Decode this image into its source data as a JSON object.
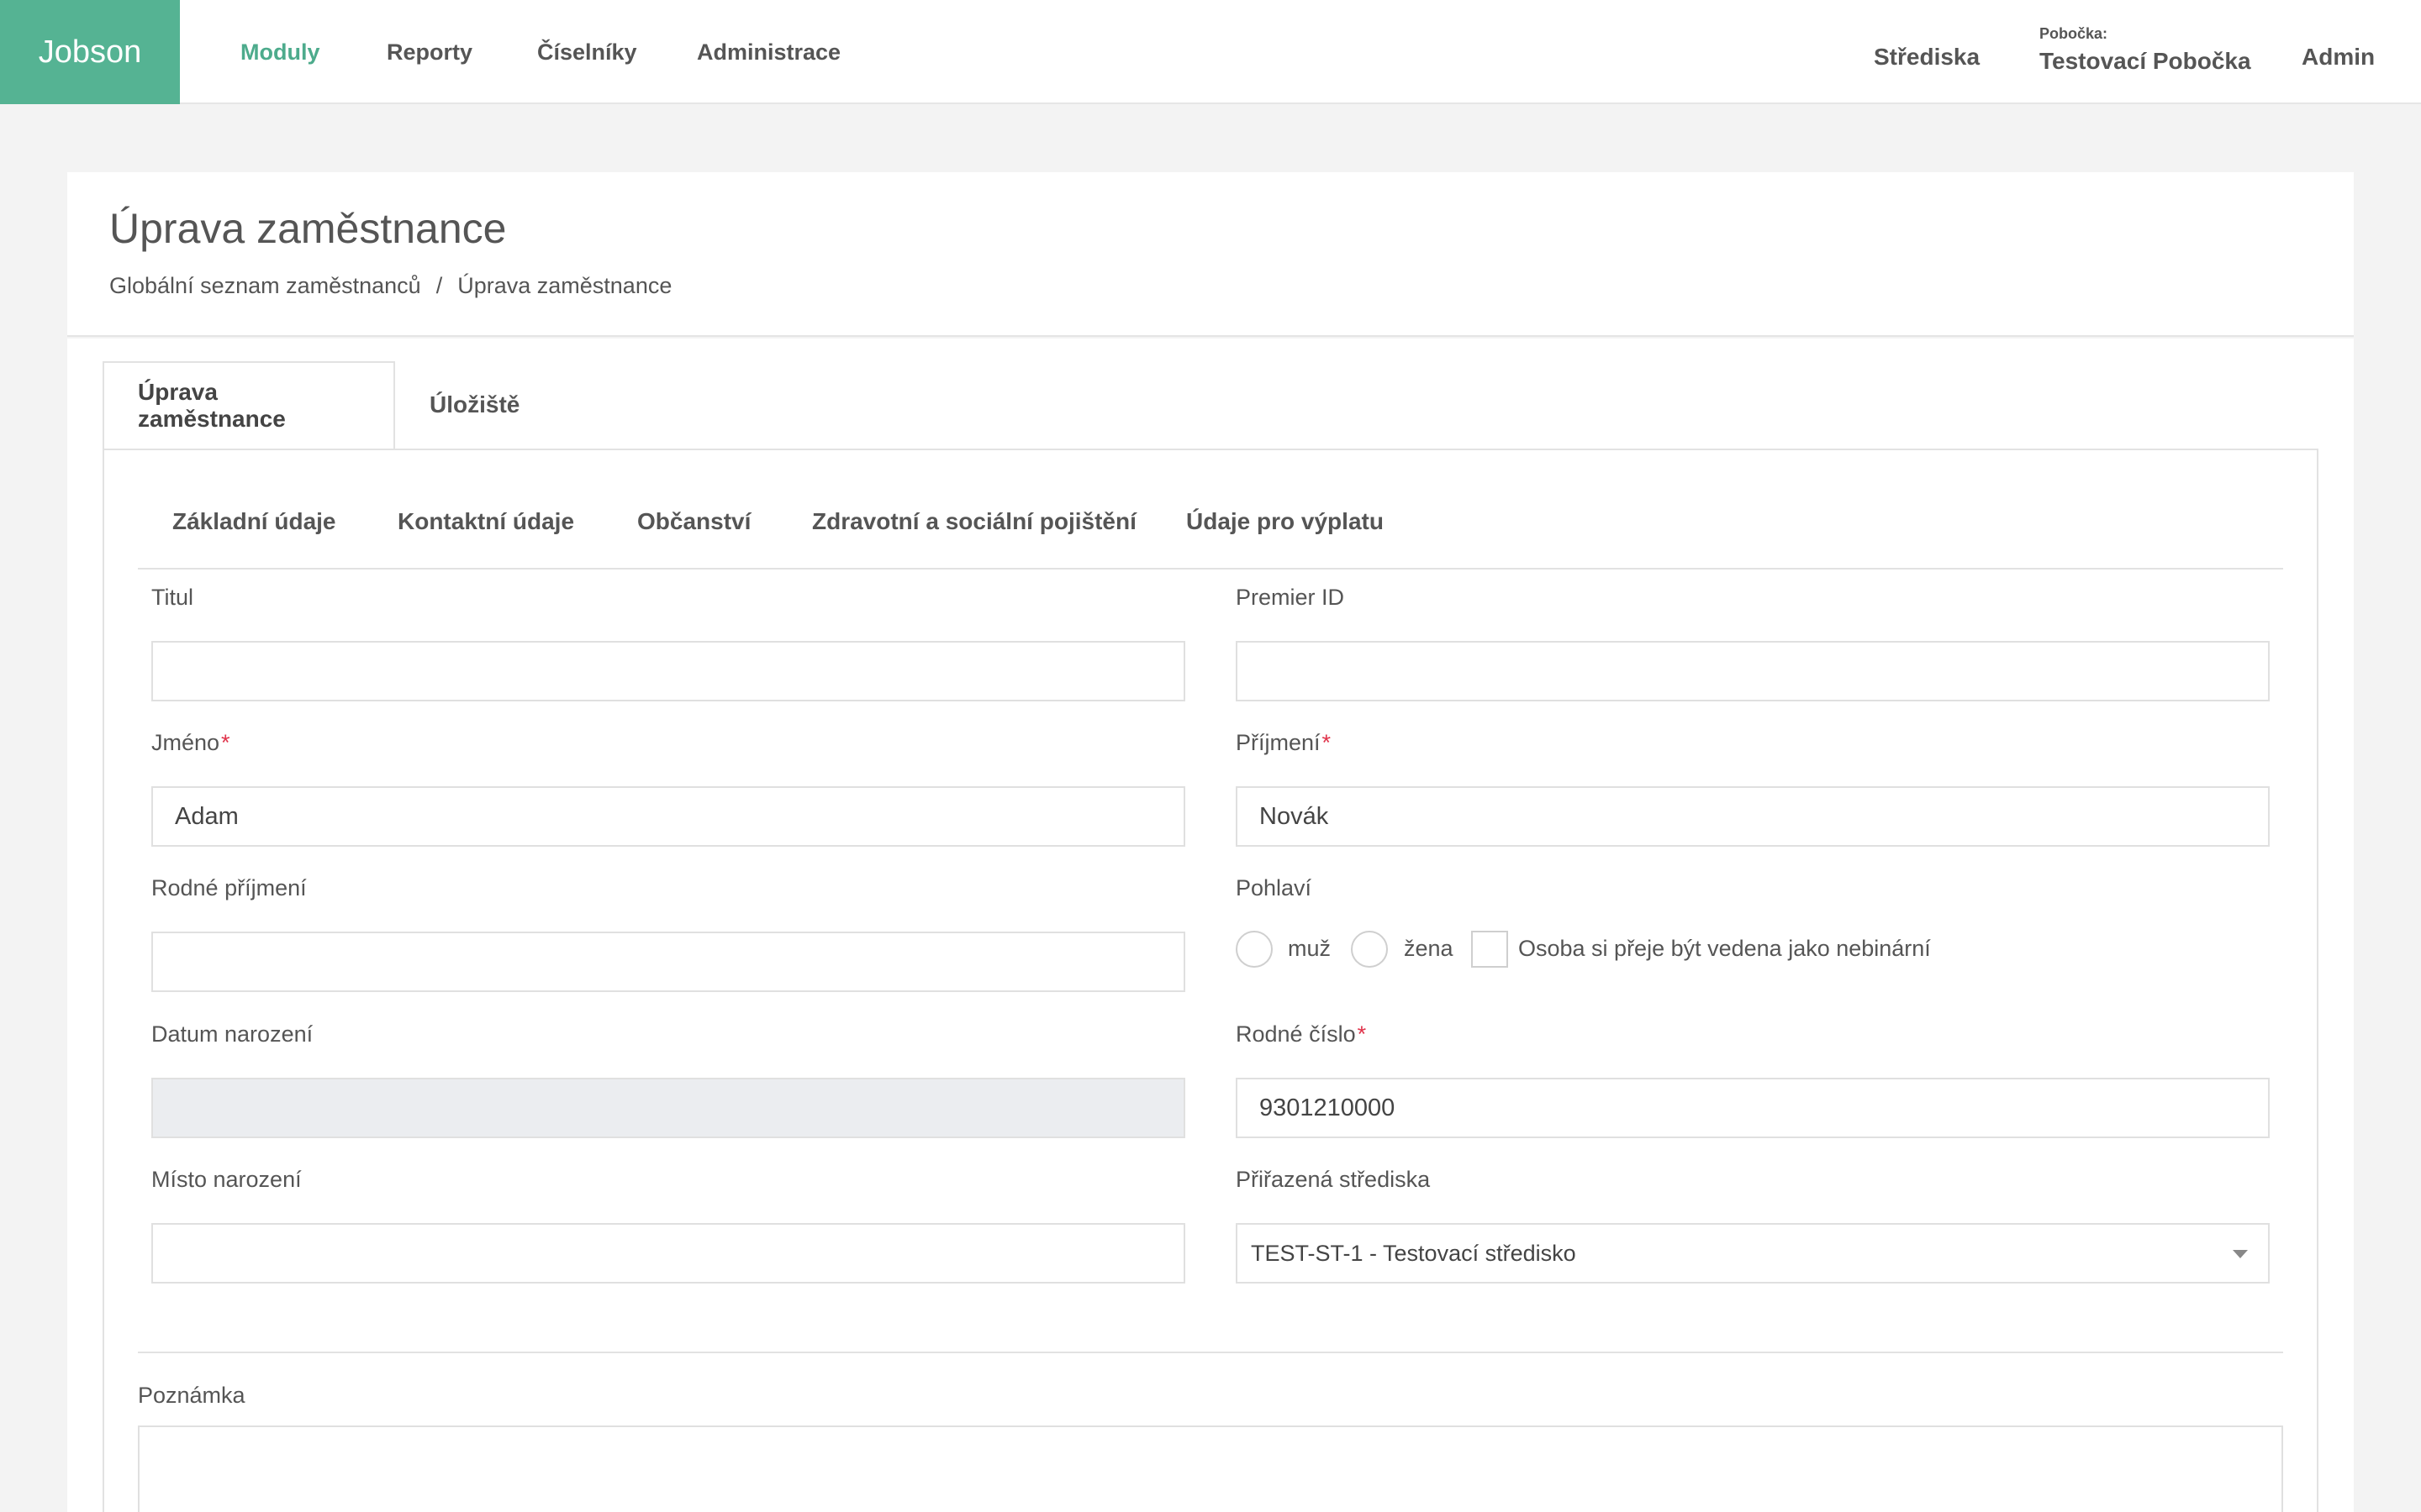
{
  "app": {
    "name": "Jobson"
  },
  "nav": {
    "items": [
      {
        "label": "Moduly",
        "active": true
      },
      {
        "label": "Reporty",
        "active": false
      },
      {
        "label": "Číselníky",
        "active": false
      },
      {
        "label": "Administrace",
        "active": false
      }
    ],
    "centers_label": "Střediska",
    "branch_caption": "Pobočka:",
    "branch_name": "Testovací Pobočka",
    "user_label": "Admin"
  },
  "page": {
    "title": "Úprava zaměstnance",
    "breadcrumb": {
      "parent": "Globální seznam zaměstnanců",
      "separator": "/",
      "current": "Úprava zaměstnance"
    }
  },
  "tabs": [
    {
      "label": "Úprava zaměstnance",
      "active": true
    },
    {
      "label": "Úložiště",
      "active": false
    }
  ],
  "subtabs": [
    "Základní údaje",
    "Kontaktní údaje",
    "Občanství",
    "Zdravotní a sociální pojištění",
    "Údaje pro výplatu"
  ],
  "form": {
    "title": {
      "label": "Titul",
      "value": ""
    },
    "premier_id": {
      "label": "Premier ID",
      "value": ""
    },
    "first_name": {
      "label": "Jméno",
      "value": "Adam",
      "required_mark": "*"
    },
    "last_name": {
      "label": "Příjmení",
      "value": "Novák",
      "required_mark": "*"
    },
    "birth_surname": {
      "label": "Rodné příjmení",
      "value": ""
    },
    "gender": {
      "label": "Pohlaví",
      "options": [
        "muž",
        "žena"
      ],
      "selected": null,
      "nonbinary_label": "Osoba si přeje být vedena jako nebinární",
      "nonbinary_checked": false
    },
    "birth_date": {
      "label": "Datum narození",
      "value": "",
      "disabled": true
    },
    "birth_number": {
      "label": "Rodné číslo",
      "value": "9301210000",
      "required_mark": "*"
    },
    "birth_place": {
      "label": "Místo narození",
      "value": ""
    },
    "assigned_centers": {
      "label": "Přiřazená střediska",
      "value": "TEST-ST-1 - Testovací středisko"
    },
    "note": {
      "label": "Poznámka",
      "value": ""
    }
  },
  "colors": {
    "brand": "#55b393",
    "nav_active": "#4dab8c",
    "required": "#e0334b",
    "disabled_input": "#ebedf0"
  }
}
